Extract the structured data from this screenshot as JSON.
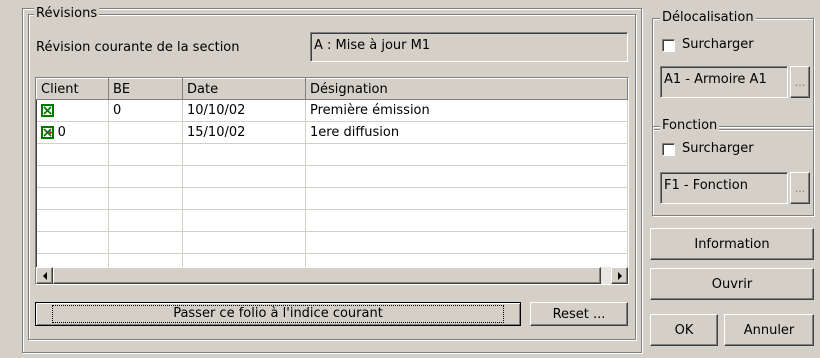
{
  "revisions": {
    "group_label": "Révisions",
    "current_label": "Révision courante de la section",
    "current_value": "A : Mise à jour M1",
    "columns": [
      "Client",
      "BE",
      "Date",
      "Désignation"
    ],
    "rows": [
      {
        "client": "",
        "be": "0",
        "date": "10/10/02",
        "designation": "Première émission"
      },
      {
        "client": "0",
        "be": "",
        "date": "15/10/02",
        "designation": "1ere diffusion"
      }
    ],
    "apply_button": "Passer ce folio à l'indice courant",
    "reset_button": "Reset ..."
  },
  "delocalisation": {
    "group_label": "Délocalisation",
    "override_label": "Surcharger",
    "value": "A1 - Armoire A1",
    "browse": "..."
  },
  "fonction": {
    "group_label": "Fonction",
    "override_label": "Surcharger",
    "value": "F1 - Fonction",
    "browse": "..."
  },
  "buttons": {
    "information": "Information",
    "ouvrir": "Ouvrir",
    "ok": "OK",
    "annuler": "Annuler"
  },
  "colors": {
    "face": "#d4d0c8",
    "check_green": "#007800",
    "accent_red": "#c00000"
  },
  "icons": [
    "checkbox-icon",
    "green-check-icon",
    "scroll-left-icon",
    "scroll-right-icon"
  ]
}
